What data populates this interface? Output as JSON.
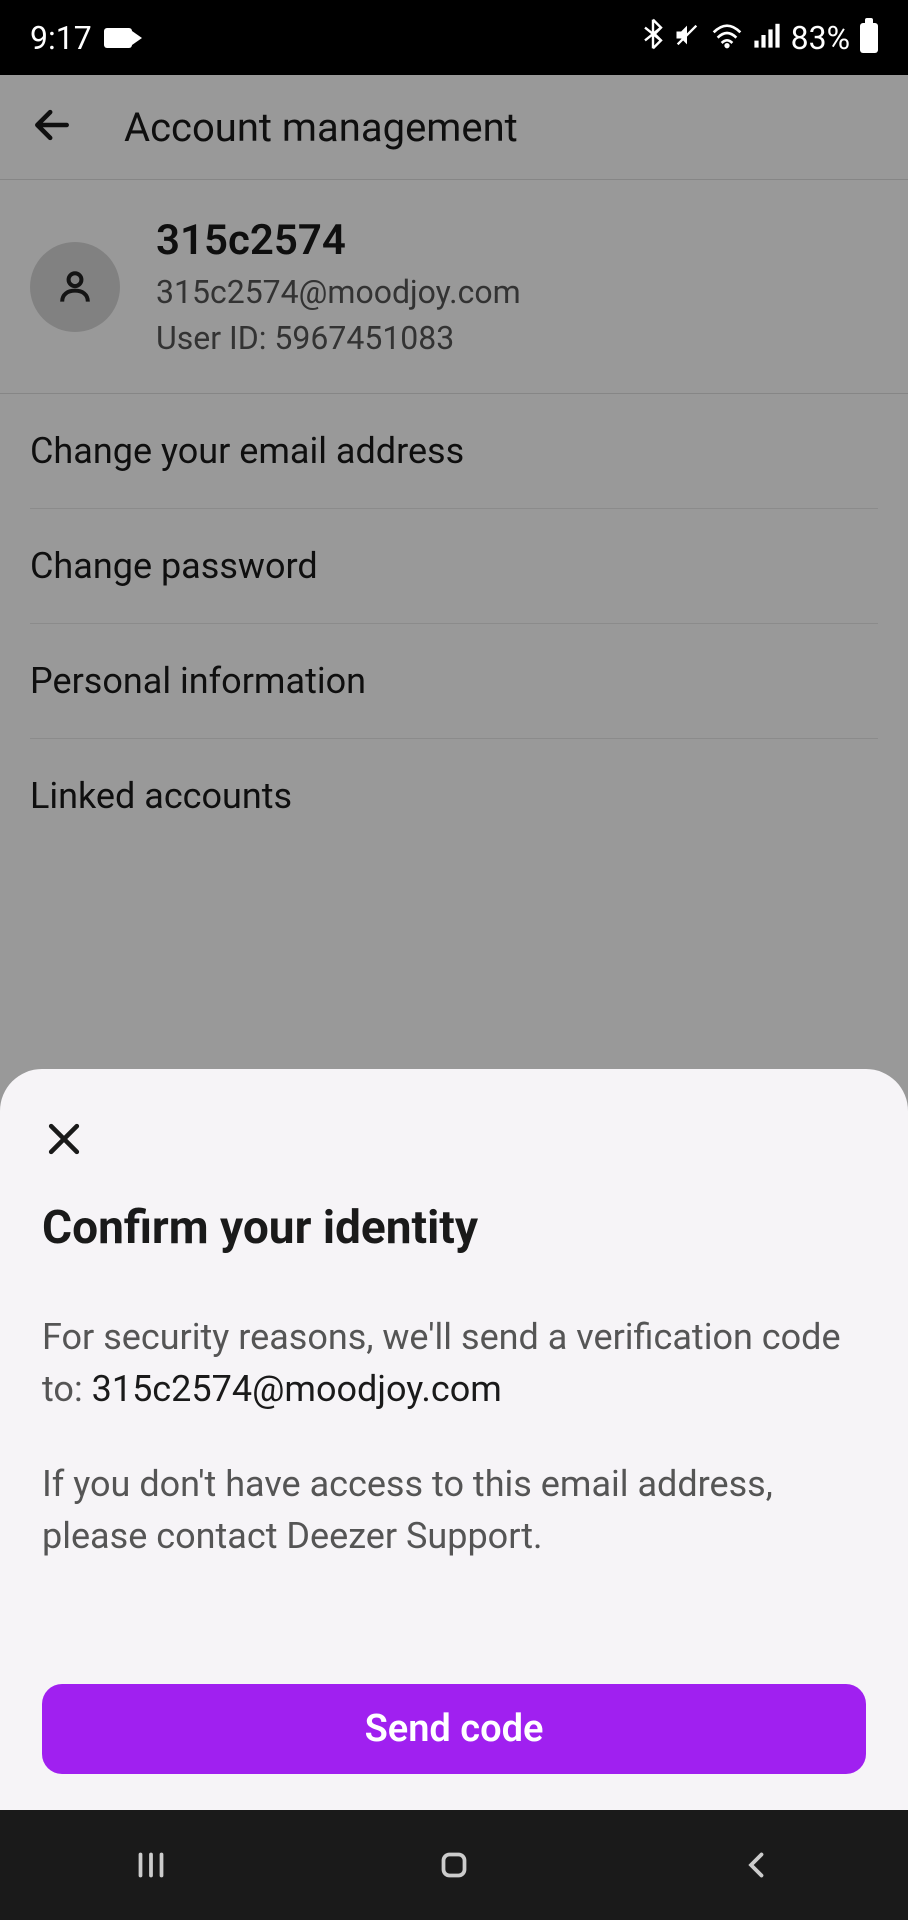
{
  "status": {
    "time": "9:17",
    "battery": "83%"
  },
  "header": {
    "title": "Account management"
  },
  "profile": {
    "name": "315c2574",
    "email": "315c2574@moodjoy.com",
    "userid_label": "User ID: 5967451083"
  },
  "menu": {
    "change_email": "Change your email address",
    "change_password": "Change password",
    "personal_info": "Personal information",
    "linked_accounts": "Linked accounts"
  },
  "sheet": {
    "title": "Confirm your identity",
    "text1_prefix": "For security reasons, we'll send a verification code to: ",
    "email": "315c2574@moodjoy.com",
    "text2": "If you don't have access to this email address, please contact Deezer Support.",
    "button": "Send code"
  }
}
